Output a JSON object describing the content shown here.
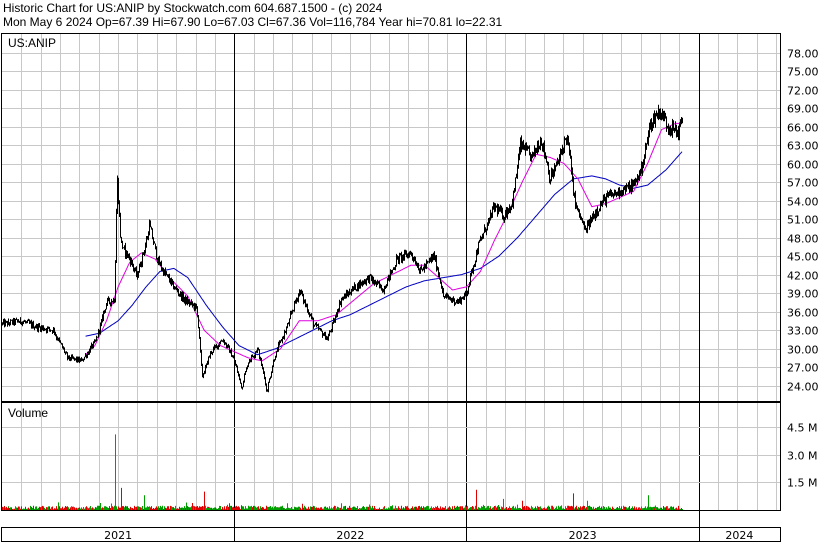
{
  "header": {
    "line1": "Historic Chart for US:ANIP by Stockwatch.com 604.687.1500 - (c) 2024",
    "line2": "Mon May  6 2024  Op=67.39  Hi=67.90  Lo=67.03  Cl=67.36  Vol=116,784  Year hi=70.81  lo=22.31"
  },
  "chart_data": {
    "type": "candlestick",
    "symbol_label": "US:ANIP",
    "volume_label": "Volume",
    "price_ticks": [
      24,
      27,
      30,
      33,
      36,
      39,
      42,
      45,
      48,
      51,
      54,
      57,
      60,
      63,
      66,
      69,
      72,
      75,
      78
    ],
    "price_tick_labels": [
      "24.00",
      "27.00",
      "30.00",
      "33.00",
      "36.00",
      "39.00",
      "42.00",
      "45.00",
      "48.00",
      "51.00",
      "54.00",
      "57.00",
      "60.00",
      "63.00",
      "66.00",
      "69.00",
      "72.00",
      "75.00",
      "78.00"
    ],
    "price_ylim": [
      21.5,
      81.0
    ],
    "volume_ticks": [
      1.5,
      3.0,
      4.5
    ],
    "volume_tick_labels": [
      "1.5 M",
      "3.0 M",
      "4.5 M"
    ],
    "volume_ylim": [
      0,
      5.8
    ],
    "years": [
      {
        "label": "2021",
        "start": 0.0,
        "end": 1.0
      },
      {
        "label": "2022",
        "start": 1.0,
        "end": 2.0
      },
      {
        "label": "2023",
        "start": 2.0,
        "end": 3.0
      },
      {
        "label": "2024",
        "start": 3.0,
        "end": 3.35
      }
    ],
    "x_range": [
      0,
      3.35
    ],
    "close_keypoints": [
      [
        0.0,
        34.0
      ],
      [
        0.08,
        34.5
      ],
      [
        0.15,
        33.5
      ],
      [
        0.22,
        33.0
      ],
      [
        0.28,
        28.5
      ],
      [
        0.34,
        28.0
      ],
      [
        0.4,
        31.0
      ],
      [
        0.45,
        37.5
      ],
      [
        0.485,
        38.0
      ],
      [
        0.495,
        58.0
      ],
      [
        0.51,
        47.0
      ],
      [
        0.55,
        44.5
      ],
      [
        0.58,
        41.5
      ],
      [
        0.61,
        46.0
      ],
      [
        0.635,
        50.0
      ],
      [
        0.67,
        44.0
      ],
      [
        0.72,
        41.0
      ],
      [
        0.78,
        38.0
      ],
      [
        0.84,
        36.5
      ],
      [
        0.86,
        25.5
      ],
      [
        0.9,
        29.5
      ],
      [
        0.95,
        31.5
      ],
      [
        1.0,
        28.0
      ],
      [
        1.03,
        23.5
      ],
      [
        1.06,
        28.0
      ],
      [
        1.1,
        30.0
      ],
      [
        1.14,
        23.0
      ],
      [
        1.17,
        28.5
      ],
      [
        1.22,
        33.0
      ],
      [
        1.28,
        39.5
      ],
      [
        1.34,
        34.0
      ],
      [
        1.4,
        31.5
      ],
      [
        1.46,
        38.0
      ],
      [
        1.52,
        40.0
      ],
      [
        1.58,
        41.5
      ],
      [
        1.64,
        39.5
      ],
      [
        1.7,
        44.5
      ],
      [
        1.76,
        45.5
      ],
      [
        1.8,
        42.5
      ],
      [
        1.86,
        45.0
      ],
      [
        1.9,
        38.5
      ],
      [
        1.96,
        37.5
      ],
      [
        2.0,
        39.0
      ],
      [
        2.04,
        45.5
      ],
      [
        2.08,
        49.5
      ],
      [
        2.12,
        53.0
      ],
      [
        2.16,
        51.5
      ],
      [
        2.2,
        54.0
      ],
      [
        2.23,
        63.0
      ],
      [
        2.28,
        61.0
      ],
      [
        2.32,
        64.0
      ],
      [
        2.36,
        57.5
      ],
      [
        2.4,
        61.0
      ],
      [
        2.43,
        64.5
      ],
      [
        2.47,
        53.0
      ],
      [
        2.51,
        49.0
      ],
      [
        2.55,
        52.0
      ],
      [
        2.6,
        54.5
      ],
      [
        2.66,
        55.5
      ],
      [
        2.72,
        56.5
      ],
      [
        2.76,
        60.0
      ],
      [
        2.79,
        66.5
      ],
      [
        2.83,
        68.5
      ],
      [
        2.87,
        66.0
      ],
      [
        2.91,
        65.0
      ],
      [
        2.93,
        67.4
      ]
    ],
    "ma_fast_keypoints": [
      [
        0.36,
        29.0
      ],
      [
        0.4,
        30.5
      ],
      [
        0.45,
        34.5
      ],
      [
        0.5,
        40.0
      ],
      [
        0.55,
        44.0
      ],
      [
        0.6,
        45.5
      ],
      [
        0.66,
        44.5
      ],
      [
        0.72,
        41.5
      ],
      [
        0.8,
        38.5
      ],
      [
        0.87,
        33.0
      ],
      [
        0.94,
        30.5
      ],
      [
        1.0,
        29.5
      ],
      [
        1.06,
        28.5
      ],
      [
        1.12,
        28.0
      ],
      [
        1.2,
        30.0
      ],
      [
        1.28,
        34.5
      ],
      [
        1.36,
        34.5
      ],
      [
        1.44,
        35.5
      ],
      [
        1.52,
        38.0
      ],
      [
        1.6,
        40.5
      ],
      [
        1.68,
        42.0
      ],
      [
        1.76,
        43.5
      ],
      [
        1.82,
        43.5
      ],
      [
        1.88,
        41.5
      ],
      [
        1.94,
        39.5
      ],
      [
        2.0,
        40.0
      ],
      [
        2.06,
        42.5
      ],
      [
        2.12,
        47.5
      ],
      [
        2.18,
        52.0
      ],
      [
        2.24,
        57.0
      ],
      [
        2.3,
        61.5
      ],
      [
        2.36,
        61.0
      ],
      [
        2.42,
        60.0
      ],
      [
        2.48,
        57.5
      ],
      [
        2.54,
        53.0
      ],
      [
        2.6,
        53.5
      ],
      [
        2.66,
        54.5
      ],
      [
        2.72,
        55.5
      ],
      [
        2.78,
        60.0
      ],
      [
        2.84,
        65.5
      ],
      [
        2.9,
        66.5
      ],
      [
        2.93,
        66.5
      ]
    ],
    "ma_slow_keypoints": [
      [
        0.36,
        32.0
      ],
      [
        0.42,
        32.5
      ],
      [
        0.5,
        34.5
      ],
      [
        0.56,
        37.0
      ],
      [
        0.62,
        40.0
      ],
      [
        0.68,
        42.5
      ],
      [
        0.74,
        43.0
      ],
      [
        0.8,
        41.5
      ],
      [
        0.88,
        37.0
      ],
      [
        0.95,
        33.5
      ],
      [
        1.02,
        30.5
      ],
      [
        1.1,
        29.0
      ],
      [
        1.18,
        30.0
      ],
      [
        1.26,
        31.5
      ],
      [
        1.34,
        33.0
      ],
      [
        1.42,
        34.5
      ],
      [
        1.5,
        35.5
      ],
      [
        1.58,
        37.0
      ],
      [
        1.66,
        38.5
      ],
      [
        1.74,
        40.0
      ],
      [
        1.82,
        41.0
      ],
      [
        1.9,
        41.5
      ],
      [
        1.98,
        42.0
      ],
      [
        2.06,
        43.0
      ],
      [
        2.14,
        45.0
      ],
      [
        2.22,
        48.0
      ],
      [
        2.3,
        51.5
      ],
      [
        2.38,
        55.0
      ],
      [
        2.46,
        57.5
      ],
      [
        2.54,
        58.0
      ],
      [
        2.6,
        57.5
      ],
      [
        2.66,
        56.5
      ],
      [
        2.72,
        56.0
      ],
      [
        2.78,
        56.5
      ],
      [
        2.86,
        59.0
      ],
      [
        2.93,
        62.0
      ]
    ],
    "volume_spikes": [
      {
        "x": 0.49,
        "v": 4.1,
        "color": "green"
      },
      {
        "x": 0.51,
        "v": 1.2,
        "color": "red"
      },
      {
        "x": 0.61,
        "v": 0.8,
        "color": "green"
      },
      {
        "x": 0.87,
        "v": 1.0,
        "color": "red"
      },
      {
        "x": 2.04,
        "v": 1.1,
        "color": "red"
      },
      {
        "x": 2.16,
        "v": 0.6,
        "color": "green"
      },
      {
        "x": 2.24,
        "v": 0.5,
        "color": "red"
      },
      {
        "x": 2.46,
        "v": 0.9,
        "color": "red"
      },
      {
        "x": 2.52,
        "v": 0.5,
        "color": "green"
      },
      {
        "x": 2.78,
        "v": 0.8,
        "color": "green"
      }
    ],
    "colors": {
      "price": "#000000",
      "ma_fast": "#e000e0",
      "ma_slow": "#0000c0",
      "grid": "#c8c8c8",
      "vol_up": "#00a000",
      "vol_down": "#e00000"
    }
  }
}
